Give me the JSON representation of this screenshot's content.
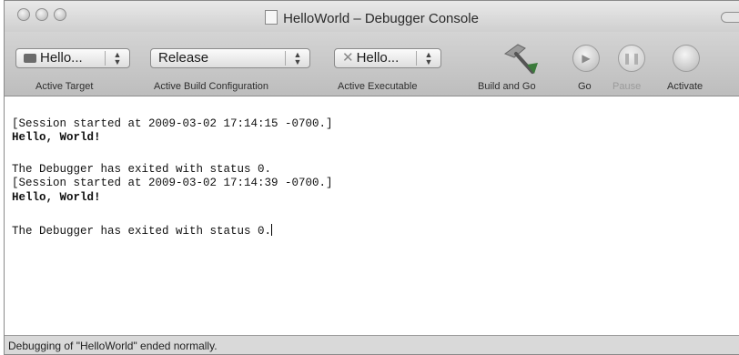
{
  "window": {
    "title": "HelloWorld – Debugger Console"
  },
  "toolbar": {
    "active_target": {
      "value": "Hello...",
      "label": "Active Target"
    },
    "build_configuration": {
      "value": "Release",
      "label": "Active Build Configuration"
    },
    "active_executable": {
      "value": "Hello...",
      "label": "Active Executable"
    },
    "build_and_go_label": "Build and Go",
    "go_label": "Go",
    "pause_label": "Pause",
    "activate_label": "Activate"
  },
  "console": {
    "lines": [
      "[Session started at 2009-03-02 17:14:15 -0700.]",
      "Hello, World!",
      "The Debugger has exited with status 0.",
      "[Session started at 2009-03-02 17:14:39 -0700.]",
      "Hello, World!",
      "The Debugger has exited with status 0."
    ]
  },
  "status": {
    "text": "Debugging of \"HelloWorld\" ended normally."
  },
  "icons": {
    "target": "target-icon",
    "executable": "executable-icon",
    "build_and_go": "hammer-icon",
    "go": "play-icon",
    "pause": "pause-icon",
    "activate": "activate-icon"
  }
}
